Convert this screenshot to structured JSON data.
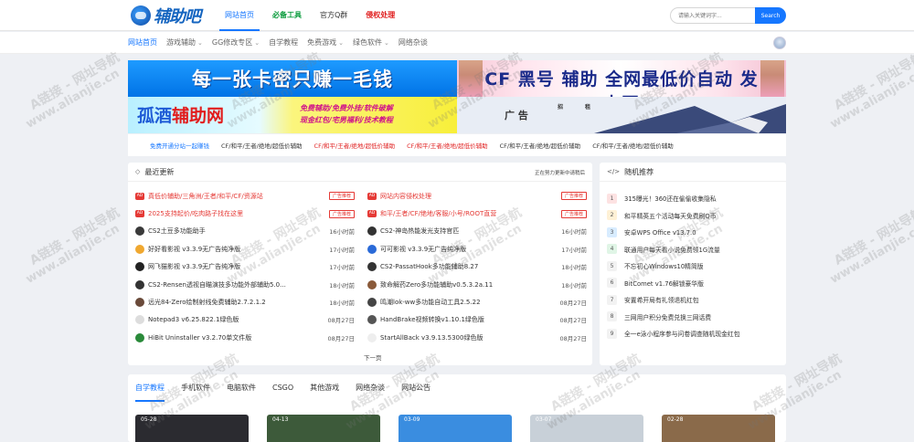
{
  "header": {
    "logo_text": "辅助吧",
    "nav": [
      {
        "label": "网站首页",
        "style": "active"
      },
      {
        "label": "必备工具",
        "style": "green"
      },
      {
        "label": "官方Q群",
        "style": "normal"
      },
      {
        "label": "侵权处理",
        "style": "red"
      }
    ],
    "search": {
      "placeholder": "请输入关键词字...",
      "button": "Search"
    }
  },
  "subnav": [
    {
      "label": "网站首页",
      "active": true,
      "dropdown": false
    },
    {
      "label": "游戏辅助",
      "active": false,
      "dropdown": true
    },
    {
      "label": "GG修改专区",
      "active": false,
      "dropdown": true
    },
    {
      "label": "自学教程",
      "active": false,
      "dropdown": false
    },
    {
      "label": "免费游戏",
      "active": false,
      "dropdown": true
    },
    {
      "label": "绿色软件",
      "active": false,
      "dropdown": true
    },
    {
      "label": "网络杂谈",
      "active": false,
      "dropdown": false
    }
  ],
  "banners": {
    "b1": "每一张卡密只赚一毛钱",
    "b2": "CF 黑号 辅助 全网最低价自动 发卡网",
    "b3_a": "孤酒",
    "b3_b": "辅助网",
    "b3_lines": [
      "免费辅助/免费外挂/软件破解",
      "现金红包/宅男福利/技术教程"
    ],
    "b4_a": "广 告",
    "b4_b": "招",
    "b4_c": "租"
  },
  "links": [
    {
      "label": "免费开通分站一起赚钱",
      "color": "#1677ff"
    },
    {
      "label": "CF/和平/王者/绝地/超低价辅助",
      "color": "#333333"
    },
    {
      "label": "CF/和平/王者/绝地/超低价辅助",
      "color": "#e02020"
    },
    {
      "label": "CF/和平/王者/绝地/超低价辅助",
      "color": "#e02020"
    },
    {
      "label": "CF/和平/王者/绝地/超低价辅助",
      "color": "#333333"
    },
    {
      "label": "CF/和平/王者/绝地/超低价辅助",
      "color": "#333333"
    }
  ],
  "latest": {
    "title": "最近更新",
    "note": "正在努力更新中请稍后",
    "more": "下一页",
    "left": [
      {
        "title": "真低价辅助/三角洲/王者/和平/CF/资源站",
        "ad": true,
        "tag": "广告推荐"
      },
      {
        "title": "2025支持起价/吃肉路子找在这里",
        "ad": true,
        "tag": "广告推荐"
      },
      {
        "title": "CS2土豆多功能助手",
        "time": "16小时前",
        "icon": "#3a3a3a"
      },
      {
        "title": "好好看影视 v3.3.9无广告纯净版",
        "time": "17小时前",
        "icon": "#f0a830"
      },
      {
        "title": "网飞猫影视 v3.3.9无广告纯净版",
        "time": "17小时前",
        "icon": "#222222"
      },
      {
        "title": "CS2-Rensen透视自瞄演技多功能外部辅助5.0...",
        "time": "18小时前",
        "icon": "#333333"
      },
      {
        "title": "远光84-Zero绘制射线免费辅助2.7.2.1.2",
        "time": "18小时前",
        "icon": "#6a4a3a"
      },
      {
        "title": "Notepad3 v6.25.822.1绿色版",
        "time": "08月27日",
        "icon": "#dddddd"
      },
      {
        "title": "HiBit Uninstaller v3.2.70单文件版",
        "time": "08月27日",
        "icon": "#2a8a3a"
      }
    ],
    "right": [
      {
        "title": "网站内容侵权处理",
        "ad": true,
        "tag": "广告推荐"
      },
      {
        "title": "和平/王者/CF/绝地/客服/小号/ROOT直营",
        "ad": true,
        "tag": "广告推荐"
      },
      {
        "title": "CS2-神岛热能发光支持官匹",
        "time": "16小时前",
        "icon": "#333333"
      },
      {
        "title": "可可影视 v3.3.9无广告纯净版",
        "time": "17小时前",
        "icon": "#2a6ad8"
      },
      {
        "title": "CS2-PassatHook多功能辅助8.27",
        "time": "18小时前",
        "icon": "#333333"
      },
      {
        "title": "致命解药Zero多功能辅助v0.5.3.2a.11",
        "time": "18小时前",
        "icon": "#8a5a3a"
      },
      {
        "title": "鸣潮lok-ww多功能自动工具2.5.22",
        "time": "08月27日",
        "icon": "#444444"
      },
      {
        "title": "HandBrake视频转换v1.10.1绿色版",
        "time": "08月27日",
        "icon": "#555555"
      },
      {
        "title": "StartAllBack v3.9.13.5300绿色版",
        "time": "08月27日",
        "icon": "#eeeeee"
      }
    ]
  },
  "random": {
    "title": "随机推荐",
    "items": [
      {
        "n": "1",
        "title": "315曝光！360还在偷偷收集隐私",
        "bg": "#fde2e2"
      },
      {
        "n": "2",
        "title": "和平精英五个活动每天免费刷Q币",
        "bg": "#fff1d6"
      },
      {
        "n": "3",
        "title": "安卓WPS Office v13.7.0",
        "bg": "#d8ecff"
      },
      {
        "n": "4",
        "title": "联通用户每天看小说免费领1G流量",
        "bg": "#e0f5e6"
      },
      {
        "n": "5",
        "title": "不忘初心Windows10精简版",
        "bg": "#f2f2f2"
      },
      {
        "n": "6",
        "title": "BitComet v1.76解锁豪华版",
        "bg": "#f2f2f2"
      },
      {
        "n": "7",
        "title": "安置希开局有礼领退机红包",
        "bg": "#f2f2f2"
      },
      {
        "n": "8",
        "title": "三网用户积分免费兑换三网话费",
        "bg": "#f2f2f2"
      },
      {
        "n": "9",
        "title": "全一e泳小程序参与问卷调查随机现金红包",
        "bg": "#f2f2f2"
      }
    ]
  },
  "tabs": [
    "自学教程",
    "手机软件",
    "电脑软件",
    "CSGO",
    "其他游戏",
    "网络杂谈",
    "网站公告"
  ],
  "thumbs": [
    {
      "date": "05-28",
      "bg": "#2b2b30"
    },
    {
      "date": "04-13",
      "bg": "#3d5a3a"
    },
    {
      "date": "03-09",
      "bg": "#3a8de0"
    },
    {
      "date": "03-07",
      "bg": "#c8d0d8"
    },
    {
      "date": "02-28",
      "bg": "#8a6a4a"
    }
  ],
  "watermark": {
    "line1": "A链接 - 网址导航",
    "line2": "www.alianjie.cn"
  }
}
